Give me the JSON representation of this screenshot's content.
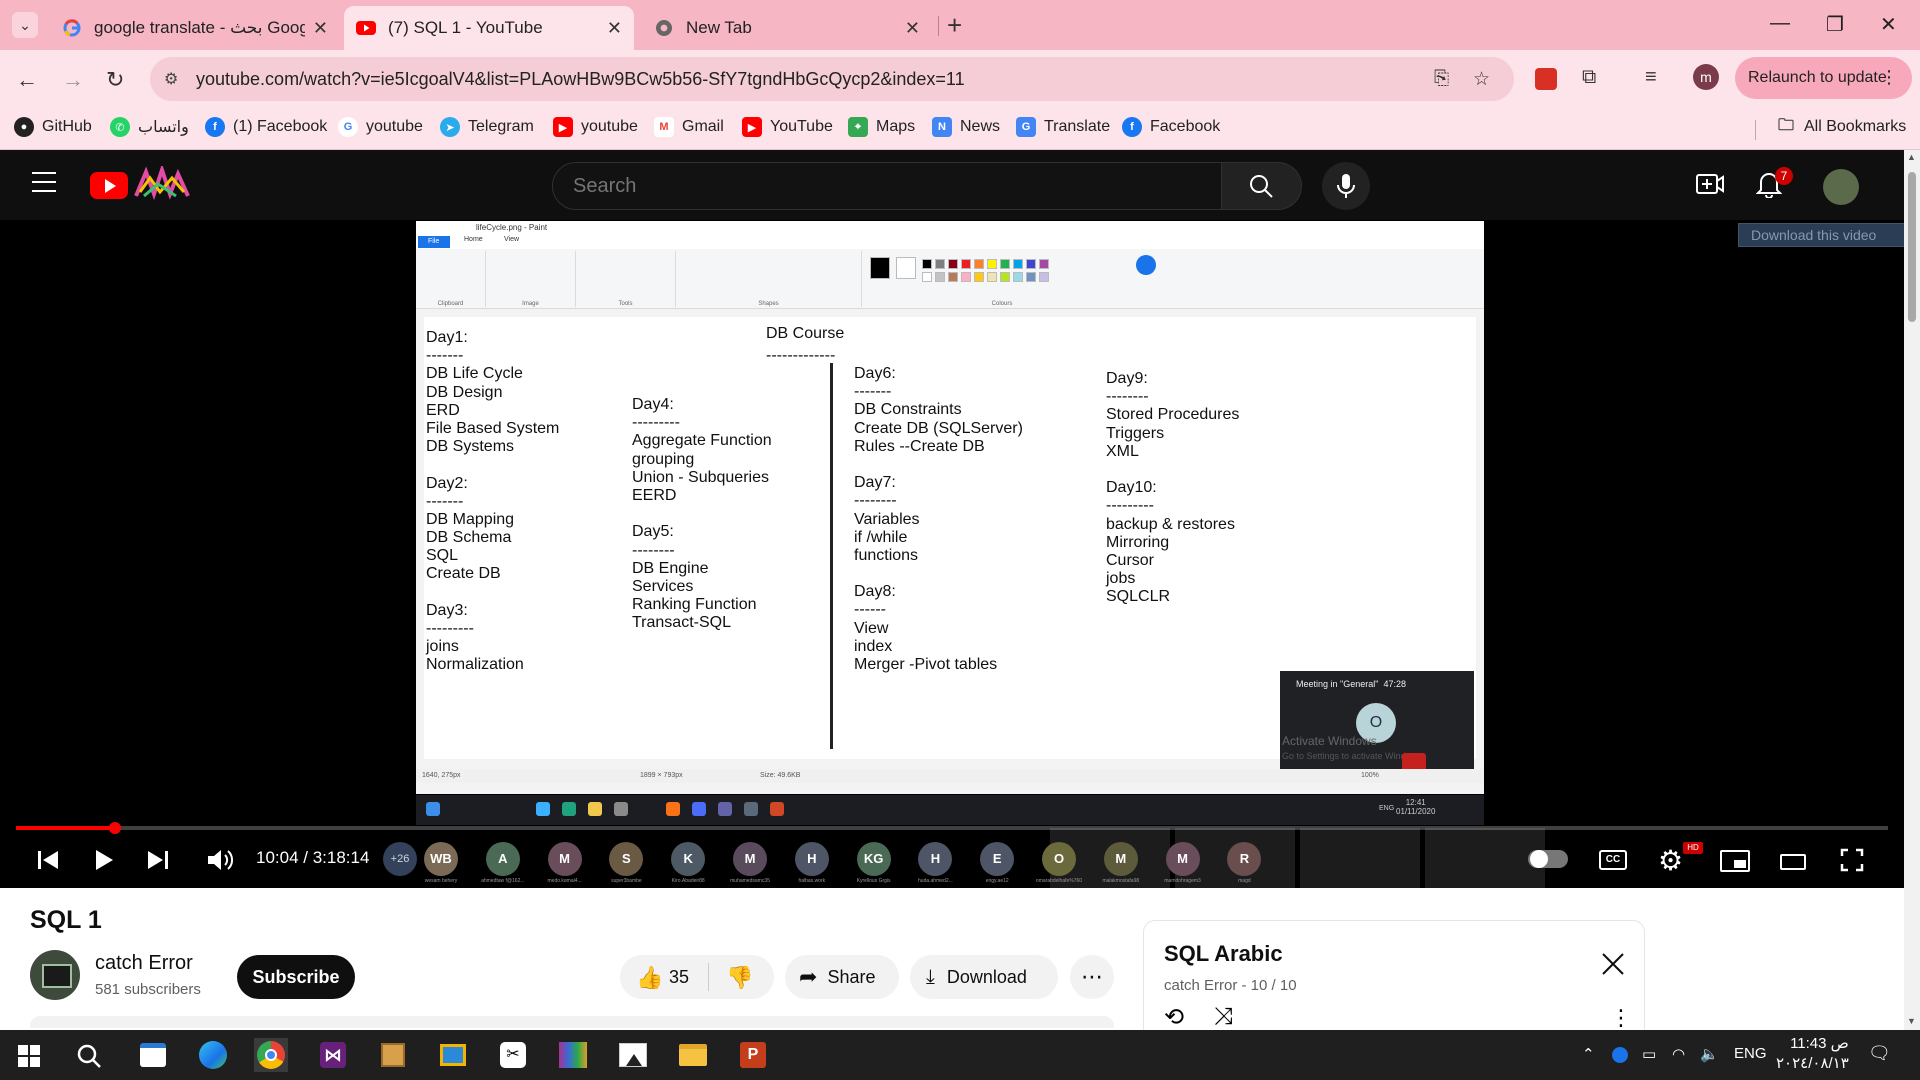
{
  "browser": {
    "tabs": [
      {
        "title": "google translate - بحث Google",
        "icon": "google-g-icon"
      },
      {
        "title": "(7) SQL 1 - YouTube",
        "icon": "youtube-icon"
      },
      {
        "title": "New Tab",
        "icon": "chrome-icon"
      }
    ],
    "url": "youtube.com/watch?v=ie5IcgoalV4&list=PLAowHBw9BCw5b56-SfY7tgndHbGcQycp2&index=11",
    "profile_initial": "m",
    "relaunch_label": "Relaunch to update",
    "bookmarks": [
      "GitHub",
      "واتساب",
      "(1) Facebook",
      "youtube",
      "Telegram",
      "youtube",
      "Gmail",
      "YouTube",
      "Maps",
      "News",
      "Translate",
      "Facebook"
    ],
    "all_bookmarks": "All Bookmarks"
  },
  "youtube": {
    "search_placeholder": "Search",
    "notification_count": "7",
    "player": {
      "time": "10:04 / 3:18:14",
      "progress": 0.053,
      "overflow_participants": "+26",
      "participants": [
        {
          "initials": "WB",
          "name": "wesam behery",
          "color": "#7b6a55"
        },
        {
          "initials": "A",
          "name": "ahmedtaw f@162...",
          "color": "#4b6a55"
        },
        {
          "initials": "M",
          "name": "medo.kamal4...",
          "color": "#6a4d5a"
        },
        {
          "initials": "S",
          "name": "super3bambe",
          "color": "#6a5a44"
        },
        {
          "initials": "K",
          "name": "Kiro.Abadeir88",
          "color": "#4d5a66"
        },
        {
          "initials": "M",
          "name": "muhamedsamc35",
          "color": "#5a4b5c"
        },
        {
          "initials": "H",
          "name": "halbas.work",
          "color": "#4d5566"
        },
        {
          "initials": "KG",
          "name": "Kyrellous Grgis",
          "color": "#4b6a56"
        },
        {
          "initials": "H",
          "name": "huda.ahmed2...",
          "color": "#4d5566"
        },
        {
          "initials": "E",
          "name": "engy.ae12",
          "color": "#4d5566"
        },
        {
          "initials": "O",
          "name": "omarabdelhafe%760",
          "color": "#6b6a3c"
        },
        {
          "initials": "M",
          "name": "malakmostafa98",
          "color": "#5e5a3c"
        },
        {
          "initials": "M",
          "name": "mamdohragem3",
          "color": "#6a4d5a"
        },
        {
          "initials": "R",
          "name": "magd",
          "color": "#6a4d4d"
        }
      ],
      "download_banner": "Download this video",
      "meeting_title": "Meeting in \"General\"",
      "meeting_time": "47:28",
      "meeting_avatar": "O",
      "activate_title": "Activate Windows",
      "activate_sub": "Go to Settings to activate Windows.",
      "paint": {
        "title": "lifeCycle.png - Paint",
        "tab_file": "File",
        "tab_home": "Home",
        "tab_view": "View",
        "groups": [
          "Clipboard",
          "Image",
          "Tools",
          "Shapes",
          "Colours"
        ],
        "status_pos": "1640, 275px",
        "status_size": "1899 × 793px",
        "status_file": "Size: 49.6KB",
        "zoom": "100%",
        "colors": [
          "#000000",
          "#7f7f7f",
          "#880015",
          "#ed1c24",
          "#ff7f27",
          "#fff200",
          "#22b14c",
          "#00a2e8",
          "#3f48cc",
          "#a349a4",
          "#ffffff",
          "#c3c3c3",
          "#b97a57",
          "#ffaec9",
          "#ffc90e",
          "#efe4b0",
          "#b5e61d",
          "#99d9ea",
          "#7092be",
          "#c8bfe7"
        ],
        "course_title": "DB Course",
        "course_rule": "-------------",
        "columns": [
          {
            "lines": [
              "Day1:",
              "-------",
              "DB Life Cycle",
              "DB Design",
              "ERD",
              "File Based System",
              "DB Systems",
              "",
              "Day2:",
              "-------",
              "DB Mapping",
              "DB Schema",
              "SQL",
              "Create DB",
              "",
              "Day3:",
              "---------",
              "joins",
              "Normalization"
            ]
          },
          {
            "lines": [
              "Day4:",
              "---------",
              "Aggregate Function",
              "grouping",
              "Union - Subqueries",
              "EERD",
              "",
              "Day5:",
              "--------",
              "DB Engine",
              "Services",
              "Ranking Function",
              "Transact-SQL"
            ]
          },
          {
            "lines": [
              "Day6:",
              "-------",
              "DB Constraints",
              "Create DB (SQLServer)",
              "Rules --Create DB",
              "",
              "Day7:",
              "--------",
              "Variables",
              "if /while",
              "functions",
              "",
              "Day8:",
              "------",
              "View",
              "index",
              "Merger -Pivot tables"
            ]
          },
          {
            "lines": [
              "Day9:",
              "--------",
              "Stored Procedures",
              "Triggers",
              "XML",
              "",
              "Day10:",
              "---------",
              "backup & restores",
              "Mirroring",
              "Cursor",
              "jobs",
              "SQLCLR"
            ]
          }
        ],
        "taskbar_time": "12:41",
        "taskbar_date": "01/11/2020",
        "taskbar_lang": "ENG"
      }
    },
    "video": {
      "title": "SQL 1",
      "channel": "catch Error",
      "subscribers": "581 subscribers",
      "subscribe_label": "Subscribe",
      "likes": "35",
      "share_label": "Share",
      "download_label": "Download"
    },
    "playlist": {
      "title": "SQL Arabic",
      "subtitle": "catch Error - 10 / 10"
    }
  },
  "windows_taskbar": {
    "lang": "ENG",
    "time": "11:43 ص",
    "date": "٢٠٢٤/٠٨/١٣"
  }
}
